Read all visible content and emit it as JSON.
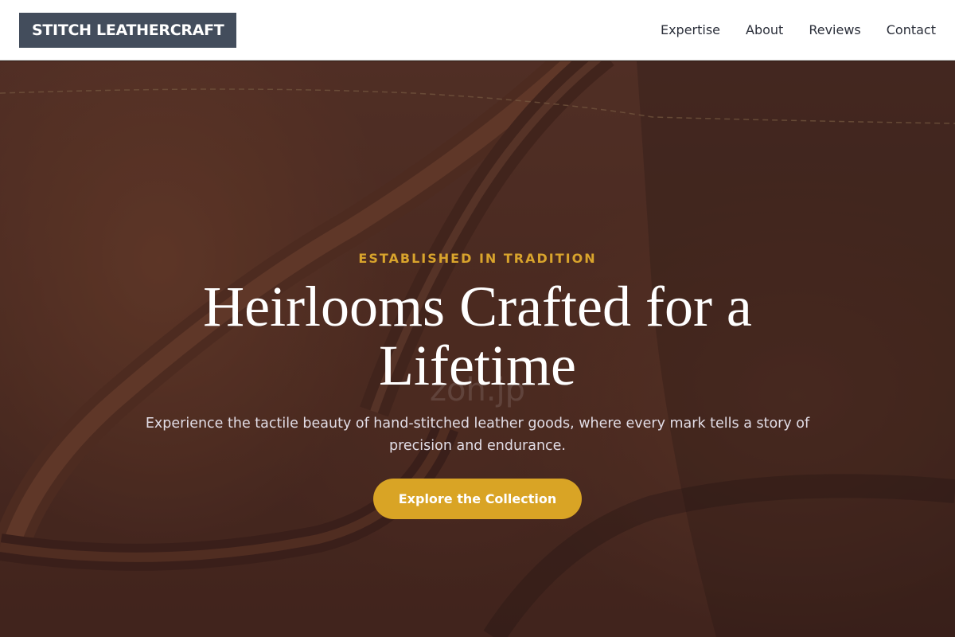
{
  "header": {
    "logo": "STITCH LEATHERCRAFT",
    "nav": [
      {
        "label": "Expertise"
      },
      {
        "label": "About"
      },
      {
        "label": "Reviews"
      },
      {
        "label": "Contact"
      }
    ]
  },
  "hero": {
    "eyebrow": "ESTABLISHED IN TRADITION",
    "title": "Heirlooms Crafted for a Lifetime",
    "subtitle": "Experience the tactile beauty of hand-stitched leather goods, where every mark tells a story of precision and endurance.",
    "cta_label": "Explore the Collection",
    "watermark": "zoh.jp"
  },
  "colors": {
    "accent": "#d9a425",
    "logo_bg": "#434d5c",
    "nav_text": "#2b2f3a"
  }
}
